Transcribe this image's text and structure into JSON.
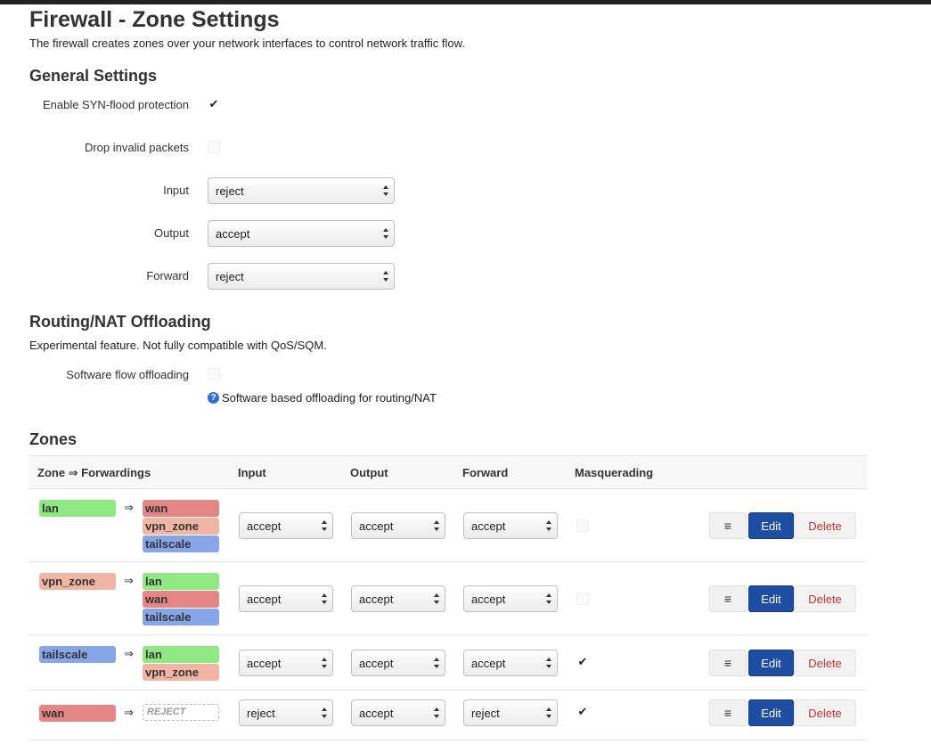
{
  "page": {
    "title": "Firewall - Zone Settings",
    "description": "The firewall creates zones over your network interfaces to control network traffic flow."
  },
  "general": {
    "title": "General Settings",
    "syn_flood": {
      "label": "Enable SYN-flood protection",
      "checked": true
    },
    "drop_invalid": {
      "label": "Drop invalid packets",
      "checked": false
    },
    "input": {
      "label": "Input",
      "value": "reject"
    },
    "output": {
      "label": "Output",
      "value": "accept"
    },
    "forward": {
      "label": "Forward",
      "value": "reject"
    }
  },
  "offloading": {
    "title": "Routing/NAT Offloading",
    "description": "Experimental feature. Not fully compatible with QoS/SQM.",
    "software_flow": {
      "label": "Software flow offloading",
      "checked": false
    },
    "hint": "Software based offloading for routing/NAT",
    "help_icon": "question-circle-icon"
  },
  "zones": {
    "title": "Zones",
    "columns": {
      "zone": "Zone ⇒ Forwardings",
      "input": "Input",
      "output": "Output",
      "forward": "Forward",
      "masq": "Masquerading"
    },
    "arrow": "⇒",
    "buttons": {
      "menu": "≡",
      "edit": "Edit",
      "delete": "Delete"
    },
    "colors": {
      "lan": "#90e882",
      "wan": "#e58686",
      "vpn_zone": "#f0b6a3",
      "tailscale": "#86a6e8"
    },
    "rows": [
      {
        "name": "lan",
        "forwards": [
          "wan",
          "vpn_zone",
          "tailscale"
        ],
        "input": "accept",
        "output": "accept",
        "forward": "accept",
        "masq": false
      },
      {
        "name": "vpn_zone",
        "forwards": [
          "lan",
          "wan",
          "tailscale"
        ],
        "input": "accept",
        "output": "accept",
        "forward": "accept",
        "masq": false
      },
      {
        "name": "tailscale",
        "forwards": [
          "lan",
          "vpn_zone"
        ],
        "input": "accept",
        "output": "accept",
        "forward": "accept",
        "masq": true
      },
      {
        "name": "wan",
        "forwards": [],
        "forward_placeholder": "REJECT",
        "input": "reject",
        "output": "accept",
        "forward": "reject",
        "masq": true
      }
    ]
  }
}
